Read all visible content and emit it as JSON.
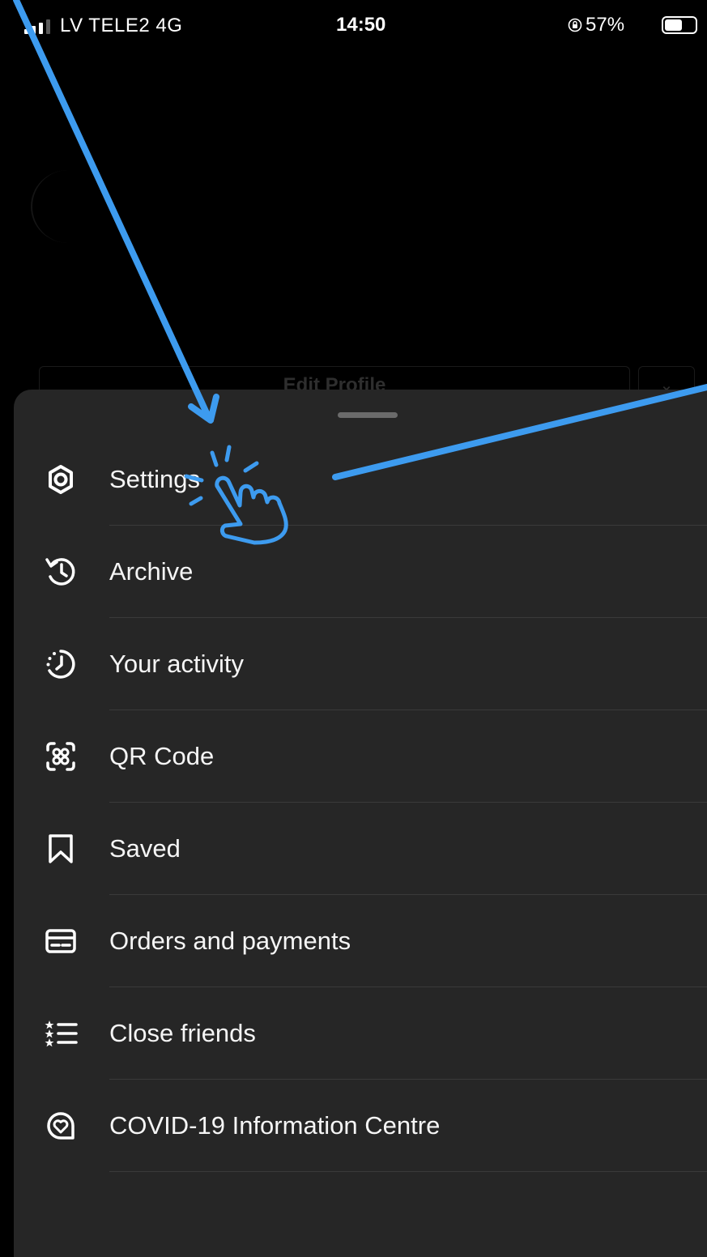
{
  "status_bar": {
    "carrier": "LV TELE2  4G",
    "time": "14:50",
    "battery_percent": "57%",
    "battery_level": 0.57,
    "icons": [
      "signal-icon",
      "orientation-lock-icon",
      "battery-icon"
    ]
  },
  "profile": {
    "edit_profile_label": "Edit Profile",
    "chevron": "⌄"
  },
  "menu": {
    "items": [
      {
        "label": "Settings",
        "icon": "gear-icon"
      },
      {
        "label": "Archive",
        "icon": "archive-clock-icon"
      },
      {
        "label": "Your activity",
        "icon": "activity-icon"
      },
      {
        "label": "QR Code",
        "icon": "qr-code-icon"
      },
      {
        "label": "Saved",
        "icon": "bookmark-icon"
      },
      {
        "label": "Orders and payments",
        "icon": "card-icon"
      },
      {
        "label": "Close friends",
        "icon": "close-friends-list-icon"
      },
      {
        "label": "COVID-19 Information Centre",
        "icon": "covid-heart-icon"
      }
    ]
  },
  "annotation": {
    "color": "#3d9bef",
    "icons": [
      "arrow-icon",
      "tap-hand-icon"
    ]
  }
}
